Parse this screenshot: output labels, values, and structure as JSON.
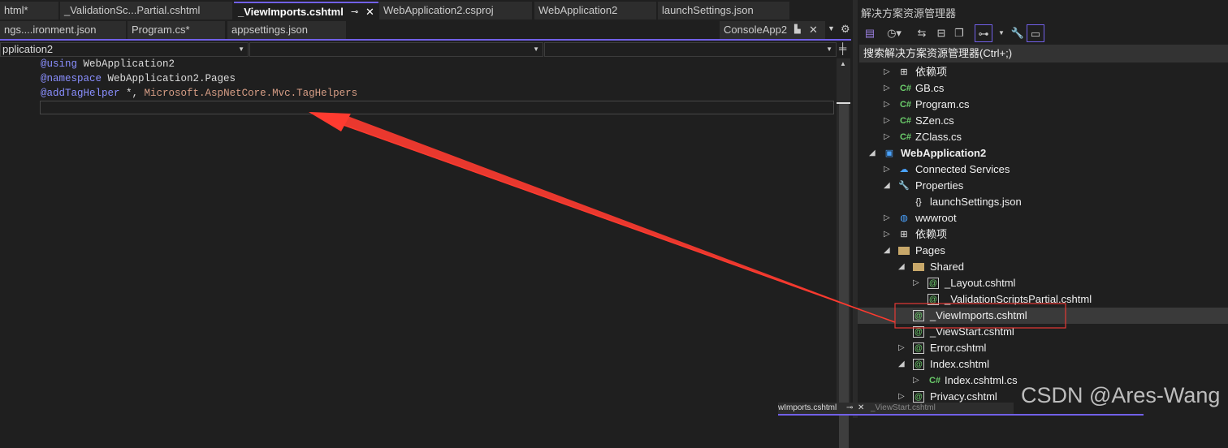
{
  "editor": {
    "tabs_row1": [
      {
        "label": "html*"
      },
      {
        "label": "_ValidationSc...Partial.cshtml"
      },
      {
        "label": "_ViewImports.cshtml",
        "active": true
      },
      {
        "label": "WebApplication2.csproj"
      },
      {
        "label": "WebApplication2"
      },
      {
        "label": "launchSettings.json"
      }
    ],
    "tabs_row2": [
      {
        "label": "ngs....ironment.json"
      },
      {
        "label": "Program.cs*"
      },
      {
        "label": "appsettings.json"
      }
    ],
    "pinned_tab": "ConsoleApp2",
    "pin_glyph": "⊸",
    "close_glyph": "X",
    "nav_dropdowns": [
      "pplication2",
      "",
      ""
    ],
    "code_lines": [
      {
        "directive": "@using",
        "rest": " WebApplication2"
      },
      {
        "directive": "@namespace",
        "rest": " WebApplication2.Pages"
      },
      {
        "directive": "@addTagHelper",
        "rest": " *, ",
        "ns": "Microsoft.AspNetCore.Mvc.TagHelpers"
      }
    ]
  },
  "solution_explorer": {
    "title": "解决方案资源管理器",
    "search_placeholder": "搜索解决方案资源管理器(Ctrl+;)",
    "items": [
      {
        "label": "依赖项",
        "level": 1,
        "expander": "collapsed",
        "icon": "dependencies-icon"
      },
      {
        "label": "GB.cs",
        "level": 1,
        "expander": "collapsed",
        "icon": "csharp-icon"
      },
      {
        "label": "Program.cs",
        "level": 1,
        "expander": "collapsed",
        "icon": "csharp-icon"
      },
      {
        "label": "SZen.cs",
        "level": 1,
        "expander": "collapsed",
        "icon": "csharp-icon"
      },
      {
        "label": "ZClass.cs",
        "level": 1,
        "expander": "collapsed",
        "icon": "csharp-icon"
      },
      {
        "label": "WebApplication2",
        "level": 0,
        "expander": "expanded",
        "icon": "web-project-icon",
        "bold": true
      },
      {
        "label": "Connected Services",
        "level": 1,
        "expander": "collapsed",
        "icon": "connected-services-icon"
      },
      {
        "label": "Properties",
        "level": 1,
        "expander": "expanded",
        "icon": "properties-icon"
      },
      {
        "label": "launchSettings.json",
        "level": 2,
        "expander": "none",
        "icon": "json-icon"
      },
      {
        "label": "wwwroot",
        "level": 1,
        "expander": "collapsed",
        "icon": "globe-icon"
      },
      {
        "label": "依赖项",
        "level": 1,
        "expander": "collapsed",
        "icon": "dependencies-icon"
      },
      {
        "label": "Pages",
        "level": 1,
        "expander": "expanded",
        "icon": "folder-icon"
      },
      {
        "label": "Shared",
        "level": 2,
        "expander": "expanded",
        "icon": "folder-icon"
      },
      {
        "label": "_Layout.cshtml",
        "level": 3,
        "expander": "collapsed",
        "icon": "razor-icon"
      },
      {
        "label": "_ValidationScriptsPartial.cshtml",
        "level": 3,
        "expander": "none",
        "icon": "razor-icon"
      },
      {
        "label": "_ViewImports.cshtml",
        "level": 2,
        "expander": "none",
        "icon": "razor-icon",
        "selected": true
      },
      {
        "label": "_ViewStart.cshtml",
        "level": 2,
        "expander": "none",
        "icon": "razor-icon"
      },
      {
        "label": "Error.cshtml",
        "level": 2,
        "expander": "collapsed",
        "icon": "razor-icon"
      },
      {
        "label": "Index.cshtml",
        "level": 2,
        "expander": "expanded",
        "icon": "razor-icon"
      },
      {
        "label": "Index.cshtml.cs",
        "level": 3,
        "expander": "collapsed",
        "icon": "csharp-icon"
      },
      {
        "label": "Privacy.cshtml",
        "level": 2,
        "expander": "collapsed",
        "icon": "razor-icon"
      }
    ]
  },
  "floating_tabs": [
    {
      "label": "wImports.cshtml"
    },
    {
      "label": "_ViewStart.cshtml"
    }
  ],
  "watermark": "CSDN @Ares-Wang",
  "colors": {
    "accent": "#7160e8",
    "annotation": "#ff3b30",
    "background": "#1f1f1f"
  }
}
